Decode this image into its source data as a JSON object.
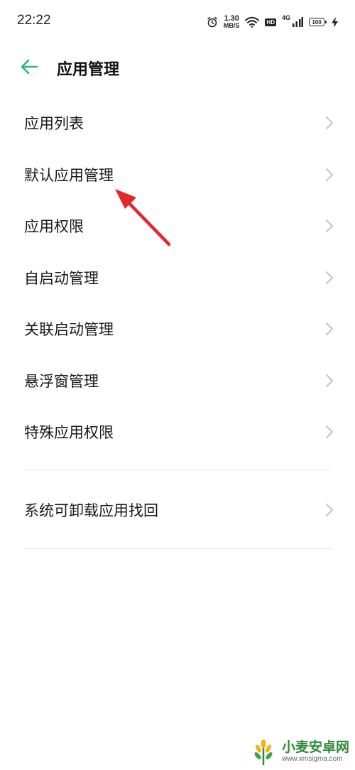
{
  "status_bar": {
    "time": "22:22",
    "net_speed_value": "1.30",
    "net_speed_unit": "MB/S",
    "hd_label": "HD",
    "network_type": "4G",
    "battery_level": "100"
  },
  "header": {
    "title": "应用管理"
  },
  "menu": {
    "items": [
      {
        "label": "应用列表"
      },
      {
        "label": "默认应用管理"
      },
      {
        "label": "应用权限"
      },
      {
        "label": "自启动管理"
      },
      {
        "label": "关联启动管理"
      },
      {
        "label": "悬浮窗管理"
      },
      {
        "label": "特殊应用权限"
      }
    ],
    "extra_items": [
      {
        "label": "系统可卸载应用找回"
      }
    ]
  },
  "watermark": {
    "title": "小麦安卓网",
    "url": "www.xmsigma.com"
  },
  "colors": {
    "accent": "#2db37a",
    "annotation_arrow": "#e5262a",
    "chevron": "#c4c4c4",
    "divider": "#e6e6e6",
    "watermark_green": "#2f8a3a"
  },
  "icons": {
    "back": "arrow-left-icon",
    "chevron": "chevron-right-icon",
    "alarm": "alarm-icon",
    "wifi": "wifi-icon",
    "signal": "signal-icon",
    "battery": "battery-icon",
    "charging": "charging-bolt-icon"
  }
}
